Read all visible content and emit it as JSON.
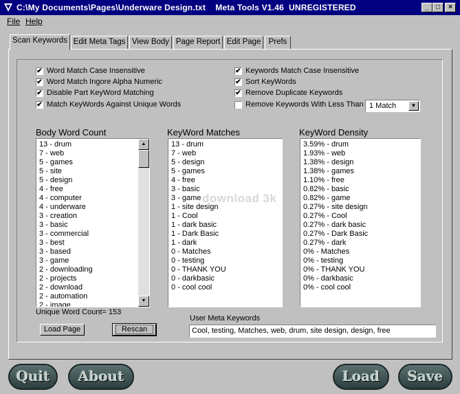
{
  "window": {
    "title": "C:\\My Documents\\Pages\\Underware Design.txt    Meta Tools V1.46  UNREGISTERED",
    "minimize_glyph": "_",
    "maximize_glyph": "□",
    "close_glyph": "×"
  },
  "menu": {
    "file": "File",
    "help": "Help"
  },
  "tabs": [
    "Scan Keywords",
    "Edit Meta Tags",
    "View Body",
    "Page Report",
    "Edit Page",
    "Prefs"
  ],
  "options_left": [
    {
      "label": "Word Match Case Insensitive",
      "checked": true
    },
    {
      "label": "Word Match Ingore Alpha Numeric",
      "checked": true
    },
    {
      "label": "Disable Part KeyWord Matching",
      "checked": true
    },
    {
      "label": "Match KeyWords Against  Unique Words",
      "checked": true
    }
  ],
  "options_right": [
    {
      "label": "Keywords Match Case Insensitive",
      "checked": true
    },
    {
      "label": "Sort KeyWords",
      "checked": true
    },
    {
      "label": "Remove Duplicate Keywords",
      "checked": true
    },
    {
      "label": "Remove Keywords With Less Than",
      "checked": false
    }
  ],
  "match_select": {
    "value": "1 Match",
    "arrow": "▼"
  },
  "headings": {
    "body_word_count": "Body Word Count",
    "keyword_matches": "KeyWord Matches",
    "keyword_density": "KeyWord Density"
  },
  "body_word_count": [
    "13 - drum",
    "7 - web",
    "5 - games",
    "5 - site",
    "5 - design",
    "4 - free",
    "4 - computer",
    "4 - underware",
    "3 - creation",
    "3 - basic",
    "3 - commercial",
    "3 - best",
    "3 - based",
    "3 - game",
    "2 - downloading",
    "2 - projects",
    "2 - download",
    "2 - automation",
    "2 - image"
  ],
  "keyword_matches": [
    "13 - drum",
    "7 - web",
    "5 - design",
    "5 - games",
    "4 - free",
    "3 - basic",
    "3 - game",
    "1 - site design",
    "1 - Cool",
    "1 - dark basic",
    "1 - Dark Basic",
    "1 - dark",
    "0 - Matches",
    "0 - testing",
    "0 - THANK YOU",
    "0 - darkbasic",
    "0 - cool cool"
  ],
  "keyword_density": [
    "3.59% - drum",
    "1.93% - web",
    "1.38% - design",
    "1.38% - games",
    "1.10% - free",
    "0.82% - basic",
    "0.82% - game",
    "0.27% - site design",
    "0.27% - Cool",
    "0.27% - dark basic",
    "0.27% - Dark Basic",
    "0.27% - dark",
    "0% - Matches",
    "0% - testing",
    "0% - THANK YOU",
    "0% - darkbasic",
    "0% - cool cool"
  ],
  "scroll_up_glyph": "▲",
  "scroll_down_glyph": "▼",
  "unique_word_count": "Unique Word Count= 153",
  "buttons": {
    "load_page": "Load Page",
    "rescan": "Rescan"
  },
  "user_meta_label": "User Meta Keywords",
  "user_meta_value": "Cool, testing, Matches, web, drum, site design, design, free",
  "bottom_buttons": {
    "quit": "Quit",
    "about": "About",
    "load": "Load",
    "save": "Save"
  },
  "watermark": "download 3k"
}
